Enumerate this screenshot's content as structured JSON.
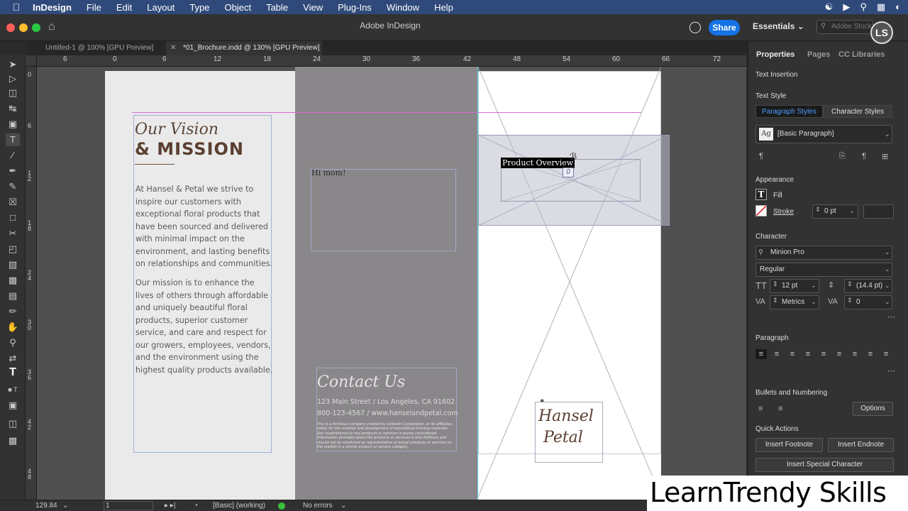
{
  "menubar": {
    "apple": "",
    "app": "InDesign",
    "items": [
      "File",
      "Edit",
      "Layout",
      "Type",
      "Object",
      "Table",
      "View",
      "Plug-Ins",
      "Window",
      "Help"
    ]
  },
  "titlebar": {
    "title": "Adobe InDesign",
    "share": "Share",
    "workspace": "Essentials",
    "search_placeholder": "Adobe Stock"
  },
  "doc_tabs": [
    {
      "label": "Untitled-1 @ 100% [GPU Preview]",
      "active": false
    },
    {
      "label": "*01_Brochure.indd @ 130% [GPU Preview]",
      "active": true
    }
  ],
  "ruler": {
    "h_labels": [
      "6",
      "0",
      "6",
      "12",
      "18",
      "24",
      "30",
      "36",
      "42",
      "48",
      "54",
      "60",
      "66",
      "72"
    ],
    "v_labels": [
      "0",
      "6",
      "1 2",
      "1 8",
      "2 4",
      "3 0",
      "3 6",
      "4 2",
      "4 8"
    ]
  },
  "document": {
    "vision_script": "Our Vision",
    "mission_heading": "& MISSION",
    "para1": "At Hansel & Petal we strive to inspire our customers with exceptional floral products that have been sourced and delivered with minimal impact on the environment, and lasting benefits on relationships and communities.",
    "para2": "Our mission is to enhance the lives of others through affordable and uniquely beautiful floral products, superior customer service, and care and respect for our growers, employees, vendors, and the environment using the highest quality products available.",
    "himom": "Hi mom!",
    "contact_head": "Contact Us",
    "contact_addr": "123 Main Street  /  Los Angeles, CA 91602",
    "contact_phone": "800-123-4567  /  www.hanselandpetal.com",
    "contact_fine": "This is a fictitious company created by LinkedIn Corporation, or its affiliates, solely for the creation and development of educational training materials. Any resemblance to real products or services is purely coincidental. Information provided about the products or services is also fictitious and should not be construed as representative of actual products or services on the market in a similar product or service category.",
    "overview_label": "Product Overview",
    "overflow_marker": "0",
    "logo_line1": "Hansel",
    "logo_line2": "Petal"
  },
  "statusbar": {
    "zoom": "129.84",
    "page": "1",
    "profile": "[Basic] (working)",
    "errors": "No errors"
  },
  "panel": {
    "tabs": [
      "Properties",
      "Pages",
      "CC Libraries"
    ],
    "text_insertion": "Text Insertion",
    "text_style": "Text Style",
    "paragraph_styles": "Paragraph Styles",
    "character_styles": "Character Styles",
    "style_value": "[Basic Paragraph]",
    "appearance": "Appearance",
    "fill": "Fill",
    "stroke": "Stroke",
    "stroke_value": "0 pt",
    "character": "Character",
    "font": "Minion Pro",
    "font_style": "Regular",
    "font_size": "12 pt",
    "leading": "(14.4 pt)",
    "kerning": "Metrics",
    "tracking": "0",
    "paragraph": "Paragraph",
    "bullets": "Bullets and Numbering",
    "options": "Options",
    "quick_actions": "Quick Actions",
    "insert_footnote": "Insert Footnote",
    "insert_endnote": "Insert Endnote",
    "insert_special": "Insert Special Character"
  },
  "watermark": "LearnTrendy Skills",
  "colors": {
    "menubar": "#2f4a7a",
    "accent": "#1473e6",
    "heading_brown": "#5a3f30",
    "margin_guide": "#d86bd8"
  }
}
